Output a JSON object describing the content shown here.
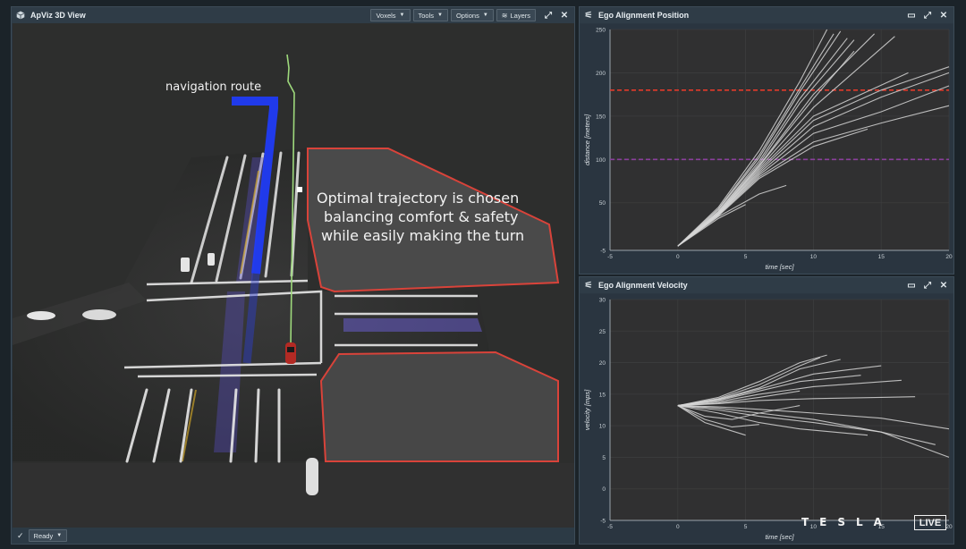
{
  "viewer": {
    "title": "ApViz 3D View",
    "toolbar": {
      "voxels": "Voxels",
      "tools": "Tools",
      "options": "Options",
      "layers": "Layers"
    },
    "status": "Ready",
    "nav_label": "navigation route",
    "caption": [
      "Optimal trajectory is chosen",
      "balancing comfort & safety",
      "while easily making the turn"
    ]
  },
  "position_panel": {
    "title": "Ego Alignment Position"
  },
  "velocity_panel": {
    "title": "Ego Alignment Velocity"
  },
  "brand": {
    "logo": "TESLA",
    "live": "LIVE"
  },
  "colors": {
    "panel": "#2b3742",
    "chart_bg": "#303031",
    "trace": "#d6d6d6",
    "red_line": "#e3392b",
    "purple_line": "#8a3f9c",
    "route_blue": "#1f3cff"
  },
  "chart_data": [
    {
      "type": "line",
      "title": "Ego Alignment Position",
      "xlabel": "time [sec]",
      "ylabel": "distance [meters]",
      "xlim": [
        -5,
        20
      ],
      "ylim": [
        -5,
        250
      ],
      "xticks": [
        -5,
        0,
        5,
        10,
        15,
        20
      ],
      "yticks": [
        -5,
        50,
        100,
        150,
        200,
        250
      ],
      "hlines": [
        {
          "y": 180,
          "color": "#e3392b"
        },
        {
          "y": 100,
          "color": "#8a3f9c"
        }
      ],
      "series": [
        {
          "x": [
            0,
            3,
            6,
            9,
            11
          ],
          "y": [
            0,
            45,
            110,
            190,
            250
          ]
        },
        {
          "x": [
            0,
            3,
            6,
            9,
            11.5
          ],
          "y": [
            0,
            43,
            105,
            182,
            245
          ]
        },
        {
          "x": [
            0,
            3,
            6,
            9,
            12
          ],
          "y": [
            0,
            42,
            102,
            178,
            248
          ]
        },
        {
          "x": [
            0,
            3,
            6,
            9,
            12.5
          ],
          "y": [
            0,
            40,
            98,
            170,
            240
          ]
        },
        {
          "x": [
            0,
            3,
            6,
            9,
            13
          ],
          "y": [
            0,
            40,
            95,
            165,
            238
          ]
        },
        {
          "x": [
            0,
            3,
            6,
            10,
            14.5
          ],
          "y": [
            0,
            39,
            93,
            175,
            245
          ]
        },
        {
          "x": [
            0,
            3,
            6,
            10,
            16
          ],
          "y": [
            0,
            38,
            90,
            160,
            242
          ]
        },
        {
          "x": [
            0,
            3,
            6,
            10,
            15,
            20
          ],
          "y": [
            0,
            37,
            86,
            145,
            180,
            207
          ]
        },
        {
          "x": [
            0,
            3,
            6,
            10,
            15,
            20
          ],
          "y": [
            0,
            37,
            84,
            138,
            172,
            200
          ]
        },
        {
          "x": [
            0,
            3,
            6,
            10,
            15,
            20
          ],
          "y": [
            0,
            36,
            82,
            130,
            155,
            185
          ]
        },
        {
          "x": [
            0,
            3,
            6,
            10,
            15,
            20
          ],
          "y": [
            0,
            36,
            80,
            120,
            142,
            162
          ]
        },
        {
          "x": [
            0,
            3,
            6,
            10,
            14
          ],
          "y": [
            0,
            35,
            78,
            115,
            135
          ]
        },
        {
          "x": [
            0,
            3,
            6,
            8
          ],
          "y": [
            0,
            34,
            60,
            70
          ]
        },
        {
          "x": [
            0,
            3,
            5
          ],
          "y": [
            0,
            32,
            48
          ]
        },
        {
          "x": [
            0,
            3,
            6,
            10,
            13
          ],
          "y": [
            0,
            38,
            92,
            170,
            225
          ]
        },
        {
          "x": [
            0,
            3,
            6,
            10,
            17
          ],
          "y": [
            0,
            37,
            88,
            150,
            200
          ]
        }
      ]
    },
    {
      "type": "line",
      "title": "Ego Alignment Velocity",
      "xlabel": "time [sec]",
      "ylabel": "velocity [mps]",
      "xlim": [
        -5,
        20
      ],
      "ylim": [
        -5,
        30
      ],
      "xticks": [
        -5,
        0,
        5,
        10,
        15,
        20
      ],
      "yticks": [
        -5,
        0,
        5,
        10,
        15,
        20,
        25,
        30
      ],
      "series": [
        {
          "x": [
            0,
            3,
            6,
            9,
            11
          ],
          "y": [
            13.2,
            14.5,
            17,
            20,
            21.2
          ]
        },
        {
          "x": [
            0,
            3,
            6,
            9,
            10.5
          ],
          "y": [
            13.2,
            14.3,
            16.5,
            19.5,
            20.8
          ]
        },
        {
          "x": [
            0,
            3,
            6,
            9,
            12
          ],
          "y": [
            13.2,
            14.2,
            16,
            19,
            20.5
          ]
        },
        {
          "x": [
            0,
            3,
            6,
            9,
            13.5
          ],
          "y": [
            13.2,
            14,
            15.5,
            17,
            18
          ]
        },
        {
          "x": [
            0,
            3,
            6,
            10,
            16.5
          ],
          "y": [
            13.2,
            13.8,
            15,
            16.2,
            17.2
          ]
        },
        {
          "x": [
            0,
            3,
            6,
            10,
            15,
            17.5
          ],
          "y": [
            13.2,
            13.5,
            14,
            14.3,
            14.5,
            14.6
          ]
        },
        {
          "x": [
            0,
            3,
            6,
            10,
            15,
            20
          ],
          "y": [
            13.2,
            13,
            12.6,
            12,
            11.2,
            9.5
          ]
        },
        {
          "x": [
            0,
            3,
            6,
            10,
            15,
            20
          ],
          "y": [
            13.2,
            12.8,
            12,
            11,
            9,
            5
          ]
        },
        {
          "x": [
            0,
            3,
            6,
            10,
            15,
            19
          ],
          "y": [
            13.2,
            12.5,
            11.5,
            10.5,
            9,
            7
          ]
        },
        {
          "x": [
            0,
            2,
            4,
            6,
            9
          ],
          "y": [
            13.2,
            11.5,
            11,
            12,
            13.2
          ]
        },
        {
          "x": [
            0,
            2,
            4,
            6
          ],
          "y": [
            13.2,
            11,
            9.8,
            10.2
          ]
        },
        {
          "x": [
            0,
            3,
            6,
            9,
            14
          ],
          "y": [
            13.2,
            12,
            10.5,
            9.5,
            8.5
          ]
        },
        {
          "x": [
            0,
            2,
            5
          ],
          "y": [
            13.2,
            10.5,
            8.5
          ]
        },
        {
          "x": [
            0,
            3,
            6,
            9
          ],
          "y": [
            13.2,
            13.6,
            14.5,
            15.5
          ]
        },
        {
          "x": [
            0,
            3,
            6,
            10,
            15
          ],
          "y": [
            13.2,
            14.1,
            15.8,
            18.2,
            19.5
          ]
        }
      ]
    }
  ]
}
